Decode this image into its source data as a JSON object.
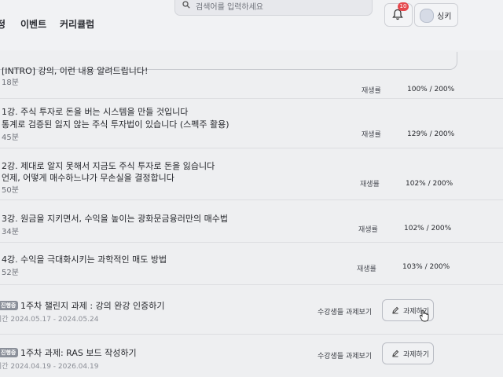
{
  "header": {
    "nav": [
      "정",
      "이벤트",
      "커리큘럼"
    ],
    "search_placeholder": "검색어를 입력하세요",
    "notification_count": "10",
    "user_name": "싱키"
  },
  "lectures": [
    {
      "title": "[INTRO] 강의, 이런 내용 알려드립니다!",
      "subtitle": "",
      "duration": "18분",
      "label": "재생률",
      "rate": "100% / 200%"
    },
    {
      "title": "1강. 주식 투자로 돈을 버는 시스템을 만들 것입니다",
      "subtitle": "통계로 검증된 잃지 않는 주식 투자법이 있습니다 (스펙주 활용)",
      "duration": "45분",
      "label": "재생률",
      "rate": "129% / 200%"
    },
    {
      "title": "2강. 제대로 알지 못해서 지금도 주식 투자로 돈을 잃습니다",
      "subtitle": "언제, 어떻게 매수하느냐가 무손실을 결정합니다",
      "duration": "50분",
      "label": "재생률",
      "rate": "102% / 200%"
    },
    {
      "title": "3강. 원금을 지키면서, 수익을 높이는 광화문금융러만의 매수법",
      "subtitle": "",
      "duration": "34분",
      "label": "재생률",
      "rate": "102% / 200%"
    },
    {
      "title": "4강. 수익을 극대화시키는 과학적인 매도 방법",
      "subtitle": "",
      "duration": "52분",
      "label": "재생률",
      "rate": "103% / 200%"
    }
  ],
  "tasks": [
    {
      "tag": "진행중",
      "title": "1주차 챌린지 과제 : 강의 완강 인증하기",
      "period": "기간 2024.05.17 - 2024.05.24",
      "view_label": "수강생들 과제보기",
      "button_label": "과제하기"
    },
    {
      "tag": "진행중",
      "title": "1주차 과제: RAS 보드 작성하기",
      "period": "기간 2024.04.19 - 2026.04.19",
      "view_label": "수강생들 과제보기",
      "button_label": "과제하기"
    }
  ]
}
